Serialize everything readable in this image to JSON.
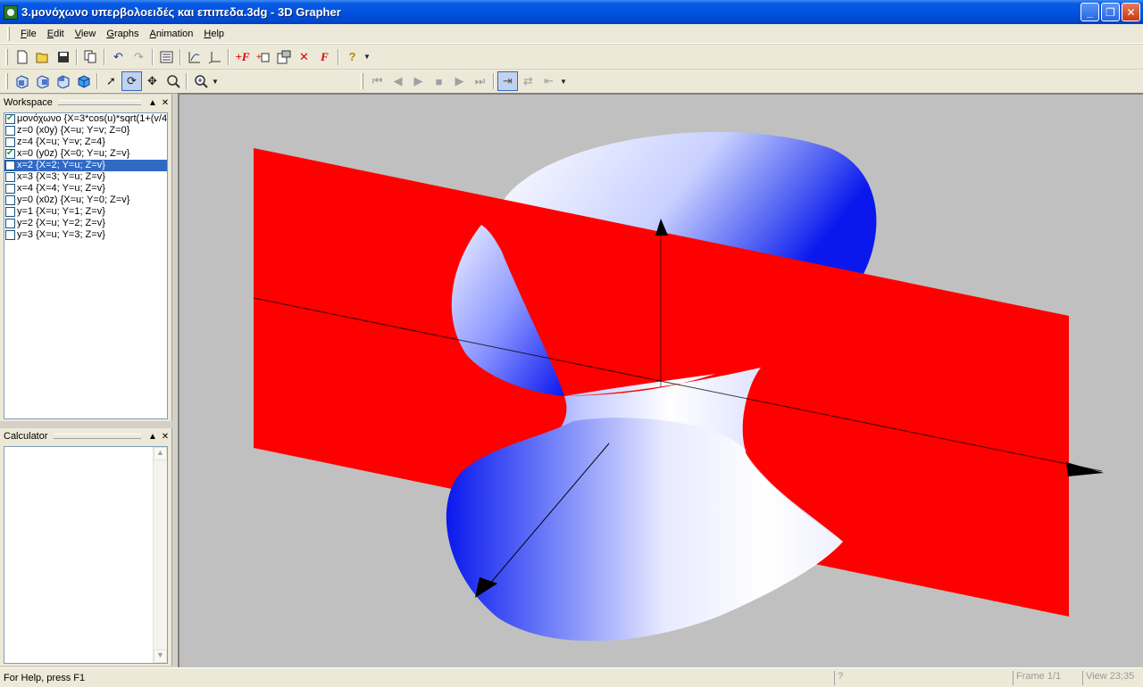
{
  "window": {
    "title": "3.μονόχωνο υπερβολοειδές και επιπεδα.3dg - 3D Grapher",
    "icon": "app-icon"
  },
  "menu": [
    {
      "label": "File"
    },
    {
      "label": "Edit"
    },
    {
      "label": "View"
    },
    {
      "label": "Graphs"
    },
    {
      "label": "Animation"
    },
    {
      "label": "Help"
    }
  ],
  "workspace": {
    "title": "Workspace",
    "items": [
      {
        "checked": true,
        "text": "μονόχωνο {X=3*cos(u)*sqrt(1+(v/4)"
      },
      {
        "checked": false,
        "text": "z=0 (x0y) {X=u; Y=v; Z=0}"
      },
      {
        "checked": false,
        "text": "z=4 {X=u; Y=v; Z=4}"
      },
      {
        "checked": true,
        "text": "x=0 (y0z) {X=0; Y=u; Z=v}"
      },
      {
        "checked": false,
        "text": "x=2 {X=2; Y=u; Z=v}",
        "selected": true
      },
      {
        "checked": false,
        "text": "x=3 {X=3; Y=u; Z=v}"
      },
      {
        "checked": false,
        "text": "x=4 {X=4; Y=u; Z=v}"
      },
      {
        "checked": false,
        "text": "y=0 (x0z) {X=u; Y=0; Z=v}"
      },
      {
        "checked": false,
        "text": "y=1 {X=u; Y=1; Z=v}"
      },
      {
        "checked": false,
        "text": "y=2 {X=u; Y=2; Z=v}"
      },
      {
        "checked": false,
        "text": "y=3 {X=u; Y=3; Z=v}"
      }
    ]
  },
  "calculator": {
    "title": "Calculator"
  },
  "status": {
    "help": "For Help, press F1",
    "indicator": "?",
    "frame": "Frame 1/1",
    "view": "View 23;35"
  },
  "colors": {
    "plane": "#ff0000",
    "surface_dark": "#0000ff",
    "surface_light": "#ffffff",
    "viewport_bg": "#c0c0c0"
  }
}
